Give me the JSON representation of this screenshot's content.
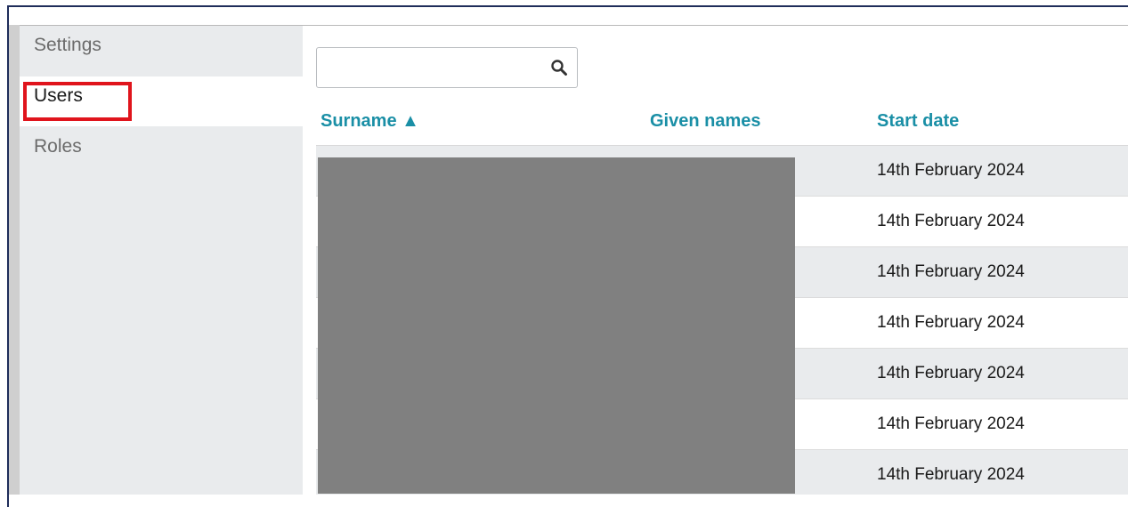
{
  "sidebar": {
    "items": [
      {
        "label": "Settings"
      },
      {
        "label": "Users"
      },
      {
        "label": "Roles"
      }
    ],
    "active_index": 1
  },
  "search": {
    "value": "",
    "placeholder": "",
    "icon": "search-icon"
  },
  "table": {
    "columns": [
      {
        "label": "Surname ▲"
      },
      {
        "label": "Given names"
      },
      {
        "label": "Start date"
      }
    ],
    "rows": [
      {
        "surname": "",
        "given_names": "",
        "start_date": "14th February 2024"
      },
      {
        "surname": "",
        "given_names": "",
        "start_date": "14th February 2024"
      },
      {
        "surname": "",
        "given_names": "",
        "start_date": "14th February 2024"
      },
      {
        "surname": "",
        "given_names": "",
        "start_date": "14th February 2024"
      },
      {
        "surname": "",
        "given_names": "",
        "start_date": "14th February 2024"
      },
      {
        "surname": "",
        "given_names": "",
        "start_date": "14th February 2024"
      },
      {
        "surname": "",
        "given_names": "",
        "start_date": "14th February 2024"
      }
    ]
  },
  "colors": {
    "accent": "#1a8fa6",
    "highlight": "#e0141c",
    "sidebar_bg": "#e9ebed",
    "redaction": "#808080"
  }
}
